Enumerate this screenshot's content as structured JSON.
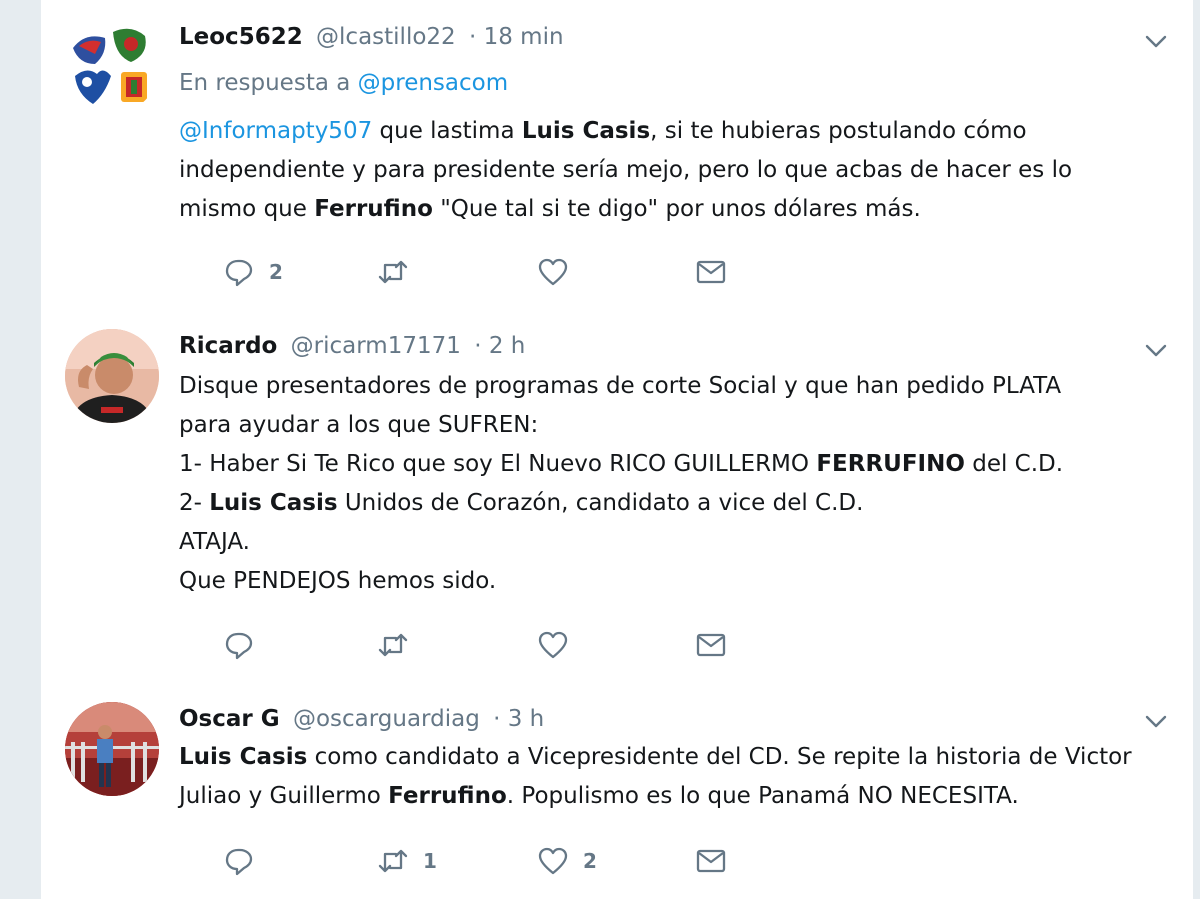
{
  "tweets": [
    {
      "name": "Leoc5622",
      "handle": "@lcastillo22",
      "time": "· 18 min",
      "reply_prefix": "En respuesta a",
      "reply_to": "@prensacom",
      "lines": [
        [
          {
            "t": "@Informapty507",
            "k": "link"
          },
          {
            "t": " que lastima "
          },
          {
            "t": "Luis Casis",
            "k": "bold"
          },
          {
            "t": ", si te hubieras postulando cómo"
          }
        ],
        [
          {
            "t": "independiente y para presidente sería mejo, pero lo que acbas de hacer es lo"
          }
        ],
        [
          {
            "t": "mismo que "
          },
          {
            "t": "Ferrufino",
            "k": "bold"
          },
          {
            "t": " \"Que tal si te digo\" por unos dólares más."
          }
        ]
      ],
      "counts": {
        "reply": "2",
        "retweet": "",
        "like": ""
      }
    },
    {
      "name": "Ricardo",
      "handle": "@ricarm17171",
      "time": "· 2 h",
      "lines": [
        [
          {
            "t": "Disque presentadores de programas de corte Social y que han pedido PLATA"
          }
        ],
        [
          {
            "t": "para ayudar a los que SUFREN:"
          }
        ],
        [
          {
            "t": "1- Haber Si  Te Rico que soy  El Nuevo RICO GUILLERMO "
          },
          {
            "t": "FERRUFINO",
            "k": "bold"
          },
          {
            "t": " del C.D."
          }
        ],
        [
          {
            "t": "2- "
          },
          {
            "t": "Luis Casis",
            "k": "bold"
          },
          {
            "t": " Unidos de Corazón, candidato a vice del C.D."
          }
        ],
        [
          {
            "t": "ATAJA."
          }
        ],
        [
          {
            "t": "Que PENDEJOS hemos sido."
          }
        ]
      ],
      "counts": {
        "reply": "",
        "retweet": "",
        "like": ""
      }
    },
    {
      "name": "Oscar G",
      "handle": "@oscarguardiag",
      "time": "· 3 h",
      "lines": [
        [
          {
            "t": "Luis Casis",
            "k": "bold"
          },
          {
            "t": " como candidato a Vicepresidente del CD. Se repite la historia de Victor"
          }
        ],
        [
          {
            "t": "Juliao y Guillermo "
          },
          {
            "t": "Ferrufino",
            "k": "bold"
          },
          {
            "t": ". Populismo es lo que Panamá NO NECESITA."
          }
        ]
      ],
      "counts": {
        "reply": "",
        "retweet": "1",
        "like": "2"
      }
    }
  ],
  "icons": {
    "reply": "reply-icon",
    "retweet": "retweet-icon",
    "like": "heart-icon",
    "dm": "envelope-icon",
    "menu": "chevron-down-icon"
  },
  "colors": {
    "link": "#1b95e0",
    "secondary": "#657786",
    "text": "#14171a",
    "background": "#e6ecf0"
  }
}
